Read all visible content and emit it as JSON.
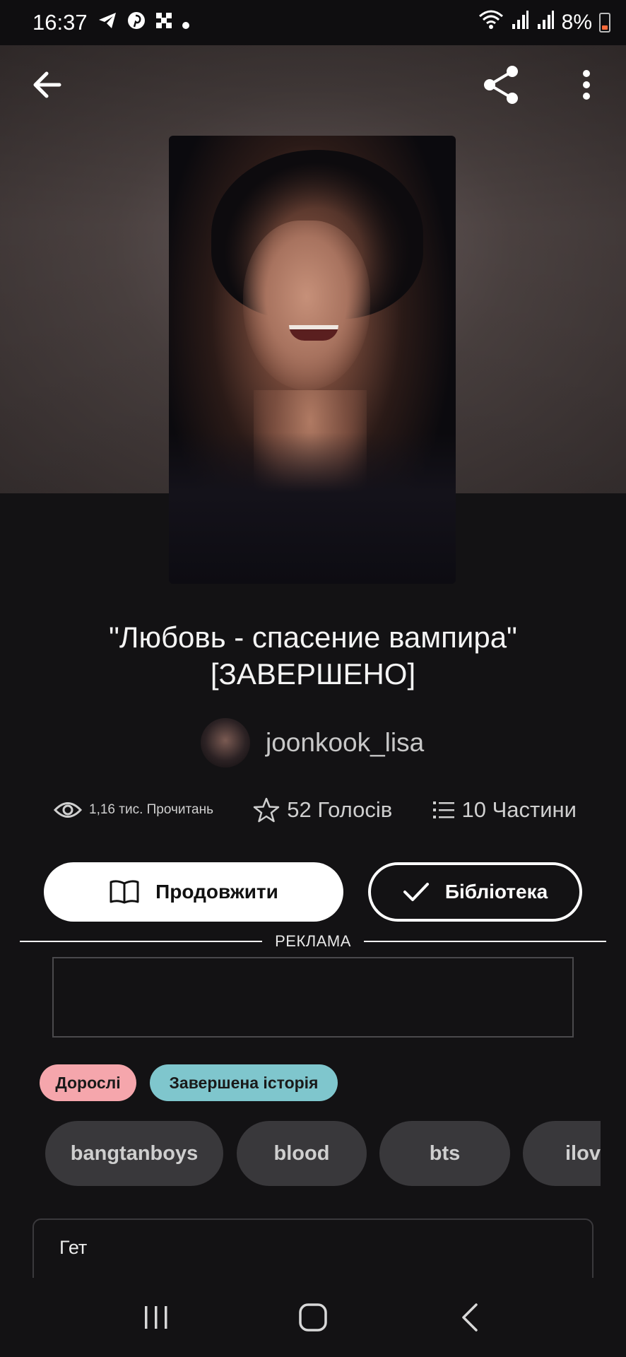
{
  "status_bar": {
    "time": "16:37",
    "battery": "8%",
    "notification_icons": [
      "telegram-icon",
      "pinterest-icon",
      "grid-app-icon",
      "dot-icon"
    ],
    "system_icons": [
      "wifi-icon",
      "signal-icon",
      "signal-icon",
      "battery-icon"
    ]
  },
  "toolbar": {
    "back_icon": "arrow-left-icon",
    "share_icon": "share-icon",
    "more_icon": "more-vertical-icon"
  },
  "story": {
    "title": "\"Любовь - спасение вампира\" [ЗАВЕРШЕНО]",
    "author": "joonkook_lisa",
    "stats": {
      "reads": "1,16 тис. Прочитань",
      "votes": "52 Голосів",
      "parts": "10 Частини"
    }
  },
  "actions": {
    "continue_label": "Продовжити",
    "library_label": "Бібліотека"
  },
  "ad": {
    "label": "РЕКЛАМА"
  },
  "badges": {
    "mature": "Дорослі",
    "completed": "Завершена історія"
  },
  "badge_colors": {
    "mature": "#f5a6ac",
    "completed": "#7fc6cd"
  },
  "tags": [
    "bangtanboys",
    "blood",
    "bts",
    "ilov"
  ],
  "description": {
    "text": "Гет"
  },
  "nav": {
    "recents_icon": "recents-icon",
    "home_icon": "home-icon",
    "back_icon": "back-chevron-icon"
  }
}
